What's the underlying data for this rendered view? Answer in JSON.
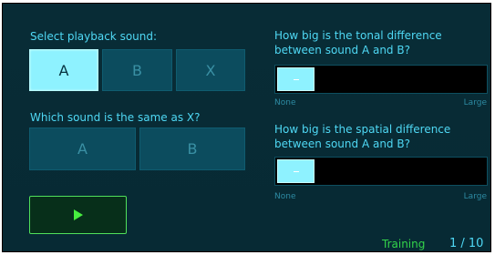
{
  "playback": {
    "title": "Select playback sound:",
    "buttons": [
      {
        "label": "A",
        "active": true
      },
      {
        "label": "B",
        "active": false
      },
      {
        "label": "X",
        "active": false
      }
    ]
  },
  "same_question": {
    "title": "Which sound is the same as X?",
    "buttons": [
      {
        "label": "A"
      },
      {
        "label": "B"
      }
    ]
  },
  "tonal": {
    "question": "How big is the tonal difference between sound A and B?",
    "min_label": "None",
    "max_label": "Large",
    "value": 0.12
  },
  "spatial": {
    "question": "How big is the spatial difference between sound A and B?",
    "min_label": "None",
    "max_label": "Large",
    "value": 0.12
  },
  "status": {
    "mode": "Training",
    "progress": "1 / 10"
  },
  "colors": {
    "background": "#072a34",
    "accent": "#4fd8f4",
    "button": "#0c4c5e",
    "button_active": "#8ef2ff",
    "play": "#47ee3f",
    "mode_text": "#33d44a"
  }
}
